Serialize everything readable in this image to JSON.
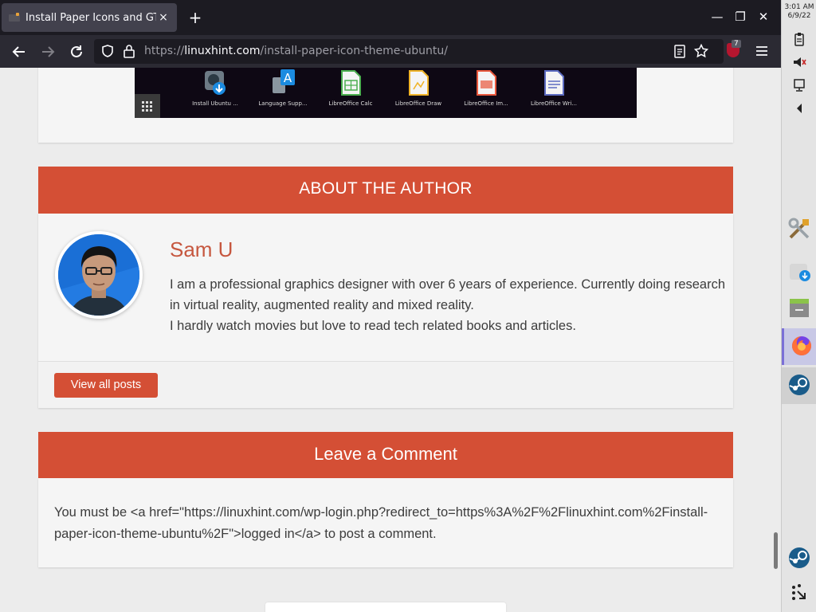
{
  "browser": {
    "tab_title": "Install Paper Icons and GTK",
    "tab_close": "×",
    "new_tab": "+",
    "url_prefix": "https://",
    "url_host": "linuxhint.com",
    "url_path": "/install-paper-icon-theme-ubuntu/",
    "ublock_count": "7",
    "window_controls": {
      "minimize": "—",
      "restore": "❐",
      "close": "✕"
    }
  },
  "launcher_apps": [
    {
      "label": "Install Ubuntu ...",
      "icon": "installer-icon"
    },
    {
      "label": "Language Supp...",
      "icon": "language-icon"
    },
    {
      "label": "LibreOffice Calc",
      "icon": "calc-icon"
    },
    {
      "label": "LibreOffice Draw",
      "icon": "draw-icon"
    },
    {
      "label": "LibreOffice Im...",
      "icon": "impress-icon"
    },
    {
      "label": "LibreOffice Wri...",
      "icon": "writer-icon"
    }
  ],
  "author_section": {
    "banner": "ABOUT THE AUTHOR",
    "name": "Sam U",
    "bio_line1": "I am a professional graphics designer with over 6 years of experience. Currently doing research in virtual reality, augmented reality and mixed reality.",
    "bio_line2": "I hardly watch movies but love to read tech related books and articles.",
    "view_posts": "View all posts"
  },
  "comment_section": {
    "banner": "Leave a Comment",
    "text": "You must be <a href=\"https://linuxhint.com/wp-login.php?redirect_to=https%3A%2F%2Flinuxhint.com%2Finstall-paper-icon-theme-ubuntu%2F\">logged in</a> to post a comment."
  },
  "system_panel": {
    "time": "3:01 AM",
    "date": "6/9/22"
  },
  "colors": {
    "accent": "#d44f35",
    "author_name": "#c6573f",
    "chrome_dark": "#1c1b22"
  }
}
